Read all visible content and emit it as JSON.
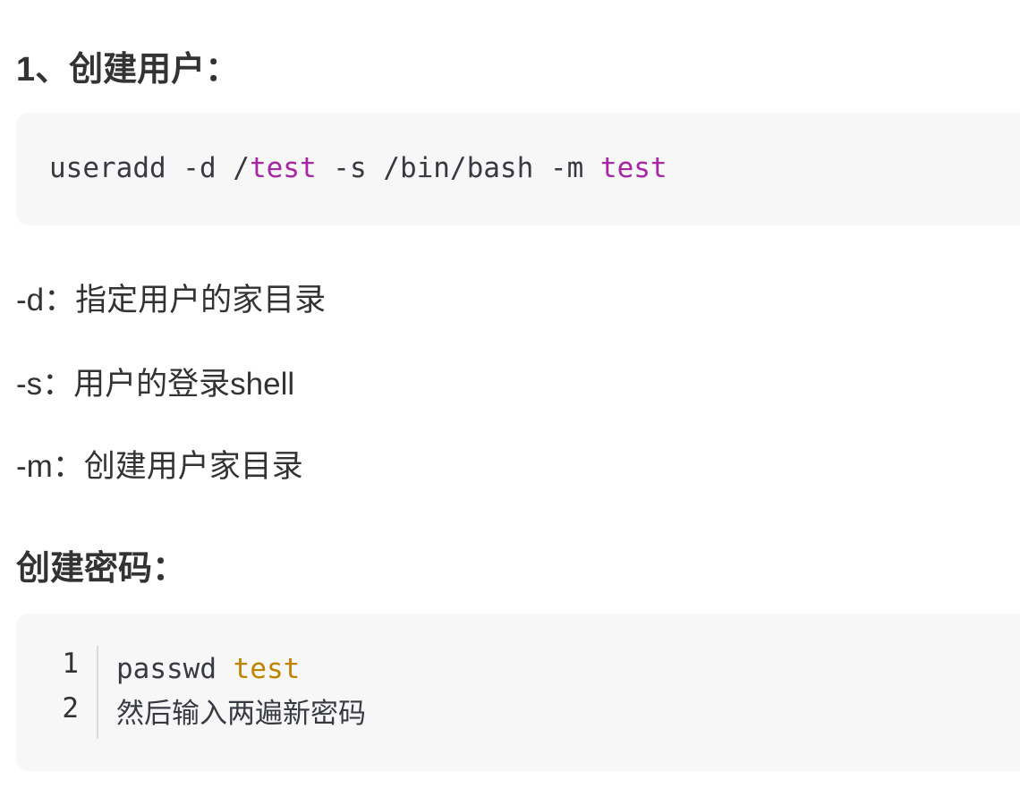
{
  "section1": {
    "heading": "1、创建用户："
  },
  "code1": {
    "seg1": "useradd -d /",
    "seg2": "test",
    "seg3": " -s /bin/bash -m ",
    "seg4": "test"
  },
  "options": [
    "-d：指定用户的家目录",
    "-s：用户的登录shell",
    "-m：创建用户家目录"
  ],
  "section2": {
    "heading": "创建密码："
  },
  "code2": {
    "line_numbers": [
      "1",
      "2"
    ],
    "line1_cmd": "passwd ",
    "line1_arg": "test",
    "line2": "然后输入两遍新密码"
  },
  "colors": {
    "keyword_purple": "#a626a4",
    "keyword_orange": "#c18401",
    "code_background": "#f7f7f8"
  }
}
